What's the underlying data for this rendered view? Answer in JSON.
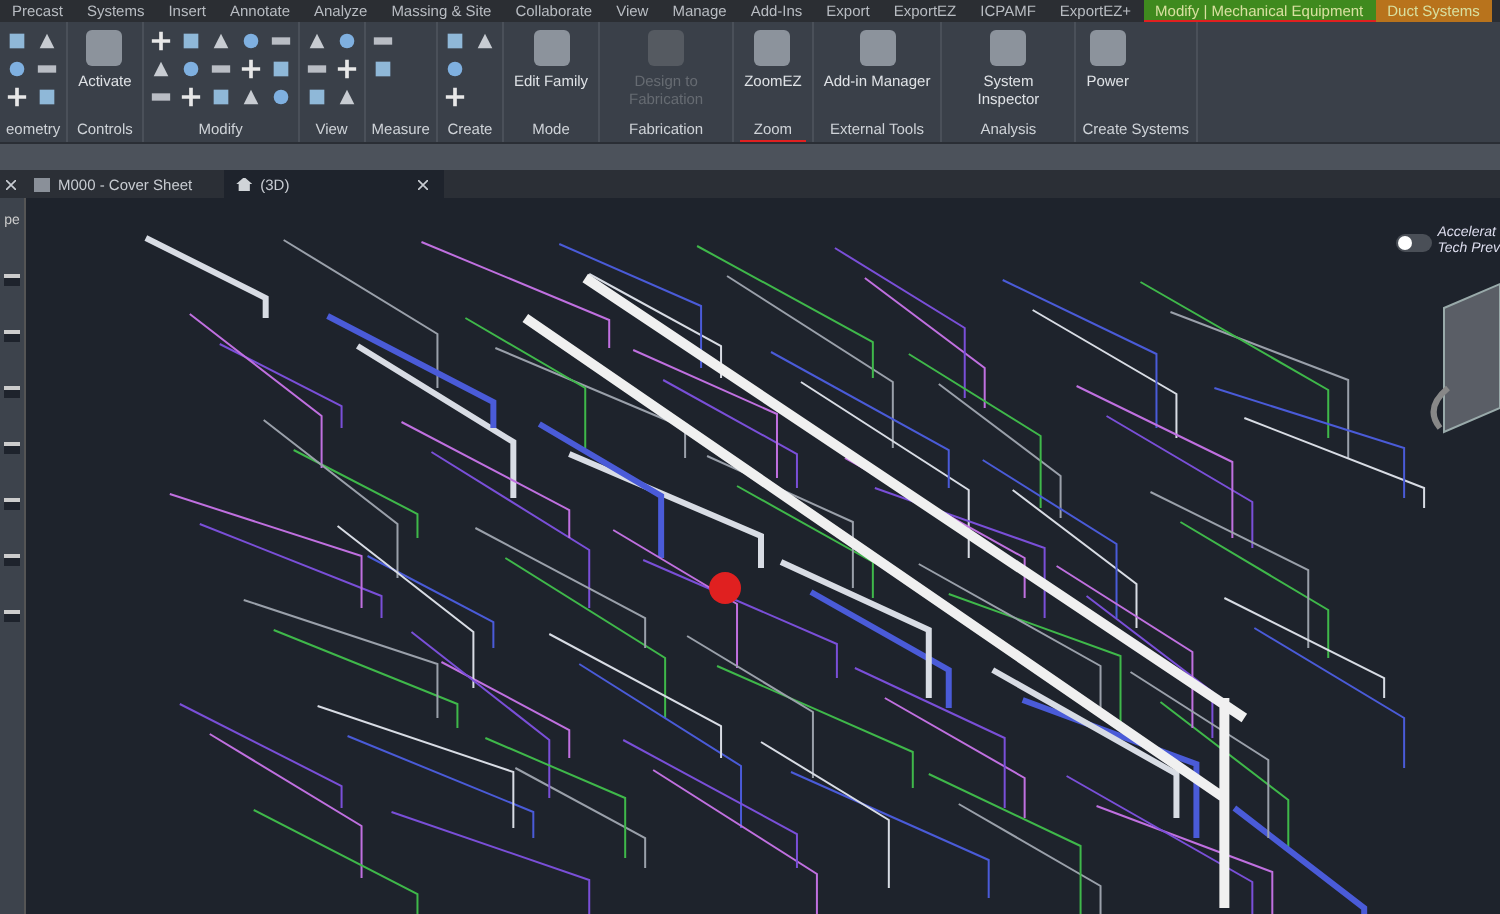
{
  "menu_tabs": [
    {
      "label": "Precast",
      "kind": "plain",
      "selected": false
    },
    {
      "label": "Systems",
      "kind": "plain",
      "selected": false
    },
    {
      "label": "Insert",
      "kind": "plain",
      "selected": false
    },
    {
      "label": "Annotate",
      "kind": "plain",
      "selected": false
    },
    {
      "label": "Analyze",
      "kind": "plain",
      "selected": false
    },
    {
      "label": "Massing & Site",
      "kind": "plain",
      "selected": false
    },
    {
      "label": "Collaborate",
      "kind": "plain",
      "selected": false
    },
    {
      "label": "View",
      "kind": "plain",
      "selected": false
    },
    {
      "label": "Manage",
      "kind": "plain",
      "selected": false
    },
    {
      "label": "Add-Ins",
      "kind": "plain",
      "selected": false
    },
    {
      "label": "Export",
      "kind": "plain",
      "selected": false
    },
    {
      "label": "ExportEZ",
      "kind": "plain",
      "selected": false
    },
    {
      "label": "ICPAMF",
      "kind": "plain",
      "selected": false
    },
    {
      "label": "ExportEZ+",
      "kind": "plain",
      "selected": false
    },
    {
      "label": "Modify | Mechanical Equipment",
      "kind": "context",
      "color": "#3f8a1e",
      "selected": true
    },
    {
      "label": "Duct Systems",
      "kind": "context",
      "color": "#b8731c",
      "selected": false
    }
  ],
  "ribbon_panels": [
    {
      "label": "eometry",
      "selected": false,
      "tools": [
        {
          "kind": "icon"
        },
        {
          "kind": "icon"
        },
        {
          "kind": "icon"
        },
        {
          "kind": "icon"
        },
        {
          "kind": "icon"
        },
        {
          "kind": "icon"
        }
      ]
    },
    {
      "label": "Controls",
      "selected": false,
      "tools": [
        {
          "kind": "large",
          "label": "Activate",
          "disabled": false
        }
      ]
    },
    {
      "label": "Modify",
      "selected": false,
      "tools": [
        {
          "kind": "icon"
        },
        {
          "kind": "icon"
        },
        {
          "kind": "icon"
        },
        {
          "kind": "icon"
        },
        {
          "kind": "icon"
        },
        {
          "kind": "icon"
        },
        {
          "kind": "icon"
        },
        {
          "kind": "icon"
        },
        {
          "kind": "icon"
        },
        {
          "kind": "icon"
        },
        {
          "kind": "icon"
        },
        {
          "kind": "icon"
        },
        {
          "kind": "icon"
        },
        {
          "kind": "icon"
        },
        {
          "kind": "icon"
        }
      ]
    },
    {
      "label": "View",
      "selected": false,
      "tools": [
        {
          "kind": "icon"
        },
        {
          "kind": "icon"
        },
        {
          "kind": "icon"
        },
        {
          "kind": "icon"
        },
        {
          "kind": "icon"
        },
        {
          "kind": "icon"
        }
      ]
    },
    {
      "label": "Measure",
      "selected": false,
      "tools": [
        {
          "kind": "icon"
        },
        {
          "kind": "icon"
        }
      ]
    },
    {
      "label": "Create",
      "selected": false,
      "tools": [
        {
          "kind": "icon"
        },
        {
          "kind": "icon"
        },
        {
          "kind": "icon"
        },
        {
          "kind": "icon"
        }
      ]
    },
    {
      "label": "Mode",
      "selected": false,
      "tools": [
        {
          "kind": "large",
          "label": "Edit Family",
          "disabled": false
        }
      ]
    },
    {
      "label": "Fabrication",
      "selected": false,
      "tools": [
        {
          "kind": "large",
          "label": "Design to Fabrication",
          "disabled": true
        }
      ]
    },
    {
      "label": "Zoom",
      "selected": true,
      "tools": [
        {
          "kind": "large",
          "label": "ZoomEZ",
          "disabled": false
        }
      ]
    },
    {
      "label": "External Tools",
      "selected": false,
      "tools": [
        {
          "kind": "large",
          "label": "Add-in Manager",
          "disabled": false
        }
      ]
    },
    {
      "label": "Analysis",
      "selected": false,
      "tools": [
        {
          "kind": "large",
          "label": "System Inspector",
          "disabled": false
        }
      ]
    },
    {
      "label": "Create Systems",
      "selected": false,
      "tools": [
        {
          "kind": "large",
          "label": "Power",
          "disabled": false
        }
      ]
    }
  ],
  "document_tabs": [
    {
      "label": "M000 - Cover Sheet",
      "selected": false
    },
    {
      "label": "(3D)",
      "selected": true
    }
  ],
  "side_panel": {
    "label": "pe"
  },
  "accelerated_graphics": {
    "on": false,
    "lines": [
      "Accelerat",
      "Tech Prev"
    ]
  }
}
